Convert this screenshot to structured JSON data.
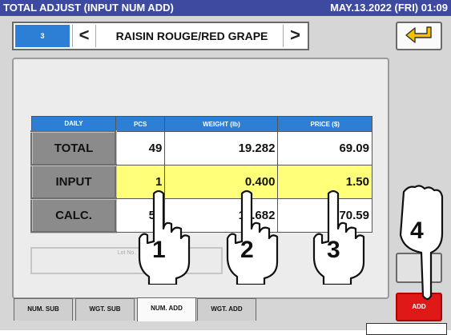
{
  "header": {
    "title": "TOTAL ADJUST (INPUT NUM ADD)",
    "datetime": "MAY.13.2022 (FRI)  01:09"
  },
  "nav": {
    "item_number": "3",
    "prev_symbol": "<",
    "item_name": "RAISIN ROUGE/RED GRAPE",
    "next_symbol": ">"
  },
  "table": {
    "headers": [
      "DAILY",
      "PCS",
      "WEIGHT (lb)",
      "PRICE ($)"
    ],
    "rows": [
      {
        "label": "TOTAL",
        "pcs": "49",
        "weight": "19.282",
        "price": "69.09"
      },
      {
        "label": "INPUT",
        "pcs": "1",
        "weight": "0.400",
        "price": "1.50"
      },
      {
        "label": "CALC.",
        "pcs": "50",
        "weight": "19.682",
        "price": "70.59"
      }
    ]
  },
  "lot": {
    "label": "Lot No."
  },
  "tabs": [
    {
      "label": "NUM. SUB"
    },
    {
      "label": "WGT. SUB"
    },
    {
      "label": "NUM. ADD"
    },
    {
      "label": "WGT. ADD"
    }
  ],
  "actions": {
    "add_label": "ADD"
  },
  "callouts": [
    "1",
    "2",
    "3",
    "4"
  ],
  "colors": {
    "title_bar": "#3d4aa0",
    "header_cell": "#2d7fd6",
    "input_highlight": "#ffff7a",
    "add_button": "#e01818"
  },
  "icons": {
    "back": "return-arrow-icon",
    "pointer": "pointing-hand-icon"
  }
}
